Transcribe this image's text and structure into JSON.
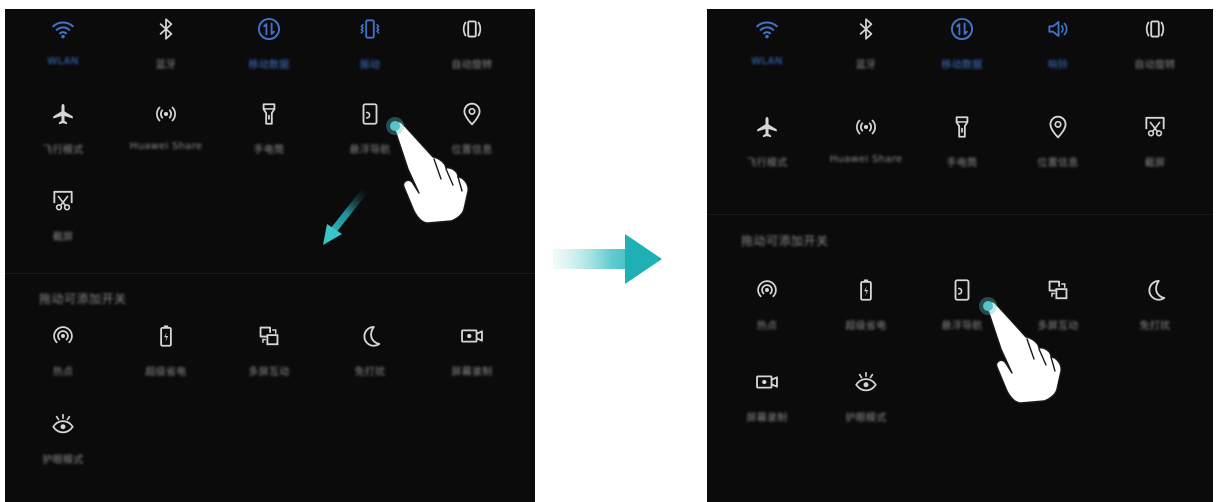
{
  "colors": {
    "panel_bg": "#0b0b0c",
    "active_blue": "#3f74c8",
    "icon_gray": "#d6d6d6",
    "label_gray": "#8a8a8a",
    "arrow_teal": "#26b3b8",
    "touch_dot": "#56c4c9"
  },
  "before": {
    "top_row": [
      {
        "icon": "wifi-icon",
        "label": "WLAN",
        "active": true
      },
      {
        "icon": "bluetooth-icon",
        "label": "蓝牙",
        "active": false
      },
      {
        "icon": "mobile-data-icon",
        "label": "移动数据",
        "active": true
      },
      {
        "icon": "vibrate-icon",
        "label": "振动",
        "active": true
      },
      {
        "icon": "auto-rotate-icon",
        "label": "自动旋转",
        "active": false
      }
    ],
    "second_row": [
      {
        "icon": "airplane-icon",
        "label": "飞行模式"
      },
      {
        "icon": "huawei-share-icon",
        "label": "Huawei Share"
      },
      {
        "icon": "flashlight-icon",
        "label": "手电筒"
      },
      {
        "icon": "floating-dock-icon",
        "label": "悬浮导航"
      },
      {
        "icon": "location-icon",
        "label": "位置信息"
      }
    ],
    "third_row": [
      {
        "icon": "screenshot-icon",
        "label": "截屏"
      }
    ],
    "drag_section_title": "拖动可添加开关",
    "drag_rows": [
      [
        {
          "icon": "hotspot-icon",
          "label": "热点"
        },
        {
          "icon": "power-saving-icon",
          "label": "超级省电"
        },
        {
          "icon": "multi-screen-icon",
          "label": "多屏互动"
        },
        {
          "icon": "do-not-disturb-icon",
          "label": "免打扰"
        },
        {
          "icon": "screen-record-icon",
          "label": "屏幕录制"
        }
      ],
      [
        {
          "icon": "eye-comfort-icon",
          "label": "护眼模式"
        }
      ]
    ]
  },
  "after": {
    "top_row": [
      {
        "icon": "wifi-icon",
        "label": "WLAN",
        "active": true
      },
      {
        "icon": "bluetooth-icon",
        "label": "蓝牙",
        "active": false
      },
      {
        "icon": "mobile-data-icon",
        "label": "移动数据",
        "active": true
      },
      {
        "icon": "sound-icon",
        "label": "响铃",
        "active": true
      },
      {
        "icon": "auto-rotate-icon",
        "label": "自动旋转",
        "active": false
      }
    ],
    "second_row": [
      {
        "icon": "airplane-icon",
        "label": "飞行模式"
      },
      {
        "icon": "huawei-share-icon",
        "label": "Huawei Share"
      },
      {
        "icon": "flashlight-icon",
        "label": "手电筒"
      },
      {
        "icon": "location-icon",
        "label": "位置信息"
      },
      {
        "icon": "screenshot-icon",
        "label": "截屏"
      }
    ],
    "drag_section_title": "拖动可添加开关",
    "drag_rows": [
      [
        {
          "icon": "hotspot-icon",
          "label": "热点"
        },
        {
          "icon": "power-saving-icon",
          "label": "超级省电"
        },
        {
          "icon": "floating-dock-icon",
          "label": "悬浮导航"
        },
        {
          "icon": "multi-screen-icon",
          "label": "多屏互动"
        },
        {
          "icon": "do-not-disturb-icon",
          "label": "免打扰"
        }
      ],
      [
        {
          "icon": "screen-record-icon",
          "label": "屏幕录制"
        },
        {
          "icon": "eye-comfort-icon",
          "label": "护眼模式"
        }
      ]
    ]
  }
}
